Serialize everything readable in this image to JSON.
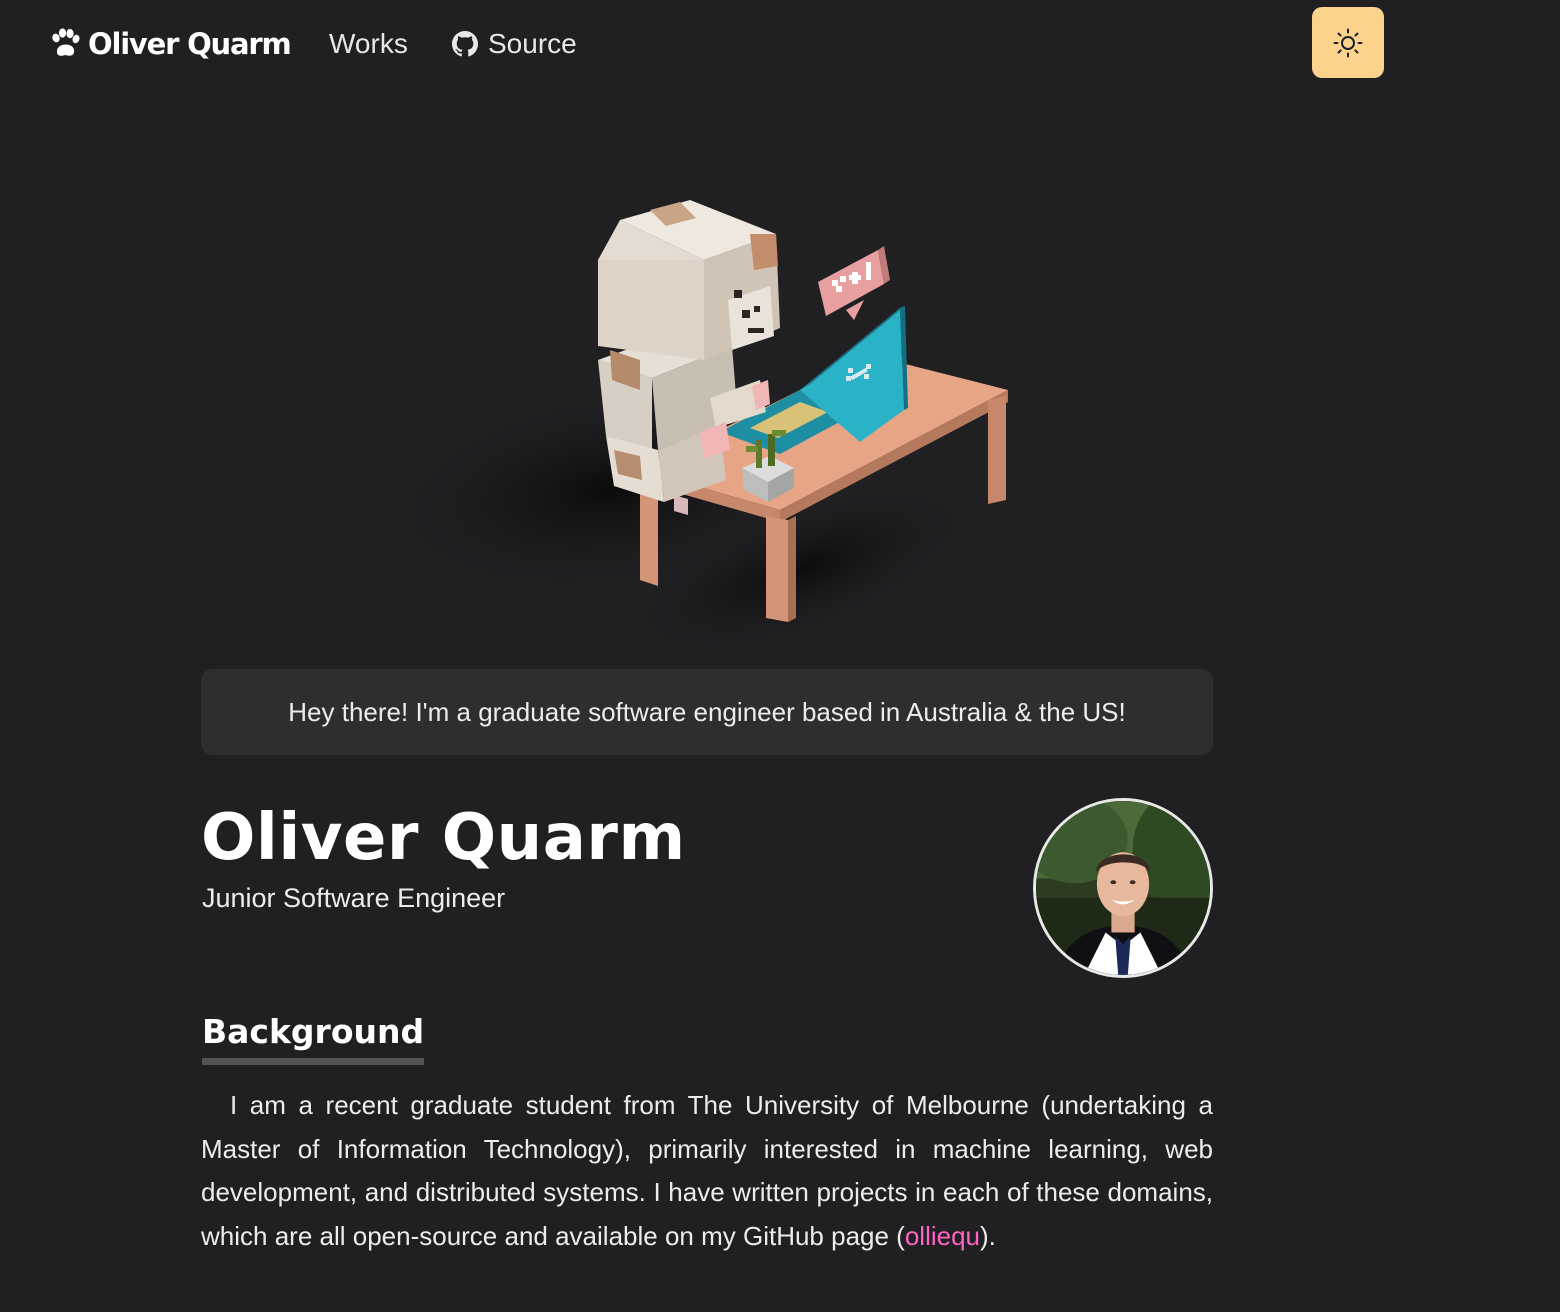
{
  "nav": {
    "logo_text": "Oliver Quarm",
    "works_label": "Works",
    "source_label": "Source",
    "theme_toggle_icon": "sun-icon"
  },
  "greeting": "Hey there! I'm a graduate software engineer based in Australia & the US!",
  "profile": {
    "name": "Oliver Quarm",
    "role": "Junior Software Engineer"
  },
  "background": {
    "heading": "Background",
    "body_before_link": "I am a recent graduate student from The University of Melbourne (undertaking a Master of Information Technology), primarily interested in machine learning, web development, and distributed systems. I have written projects in each of these domains, which are all open-source and available on my GitHub page (",
    "link_text": "olliequ",
    "body_after_link": ")."
  },
  "colors": {
    "background": "#202023",
    "accent_toggle": "#fbd38d",
    "link": "#ff63c3",
    "greeting_box": "#2e2e31"
  }
}
